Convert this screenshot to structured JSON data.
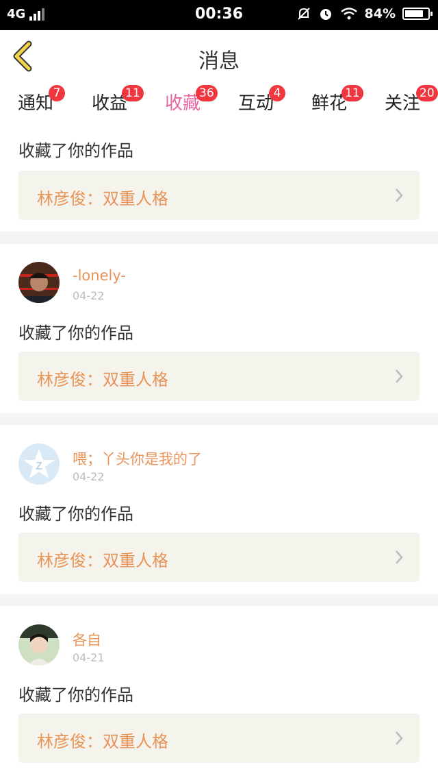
{
  "status_bar": {
    "network": "4G",
    "time": "00:36",
    "battery": "84%"
  },
  "header": {
    "title": "消息",
    "back_icon": "chevron-left-icon"
  },
  "tabs": [
    {
      "label": "通知",
      "badge": "7"
    },
    {
      "label": "收益",
      "badge": "11"
    },
    {
      "label": "收藏",
      "badge": "36",
      "active": true
    },
    {
      "label": "互动",
      "badge": "4"
    },
    {
      "label": "鲜花",
      "badge": "11"
    },
    {
      "label": "关注",
      "badge": "20"
    }
  ],
  "messages": [
    {
      "user": "",
      "date": "",
      "action": "收藏了你的作品",
      "work": "林彦俊：双重人格"
    },
    {
      "user": "-lonely-",
      "date": "04-22",
      "action": "收藏了你的作品",
      "work": "林彦俊：双重人格"
    },
    {
      "user": "喂；丫头你是我的了",
      "date": "04-22",
      "action": "收藏了你的作品",
      "work": "林彦俊：双重人格"
    },
    {
      "user": "各自",
      "date": "04-21",
      "action": "收藏了你的作品",
      "work": "林彦俊：双重人格"
    }
  ],
  "colors": {
    "accent": "#e4679f",
    "badge": "#f0363f",
    "username": "#e99359",
    "work_bg": "#f4f4ec"
  }
}
